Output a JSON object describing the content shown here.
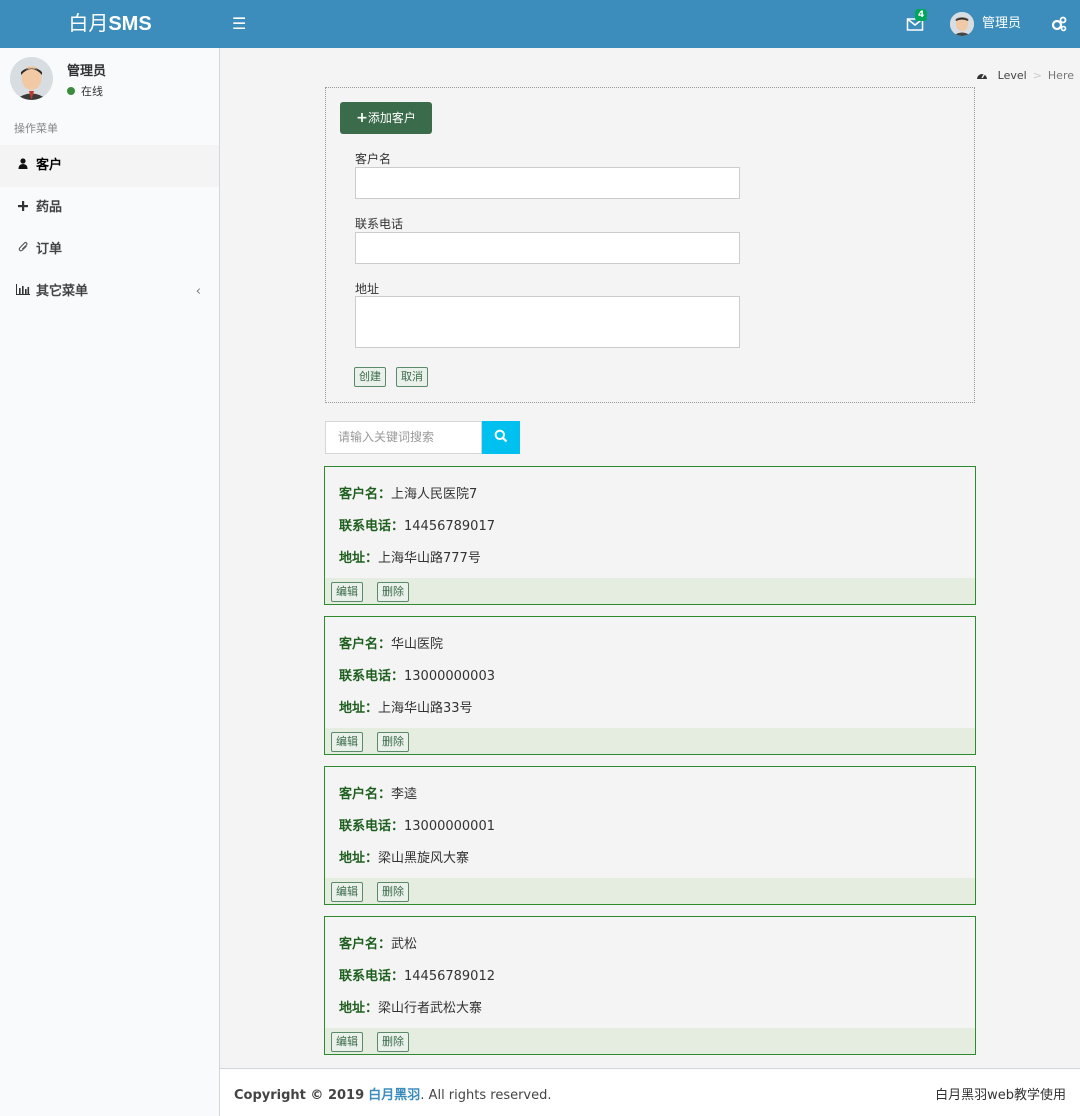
{
  "header": {
    "logo_light": "白月",
    "logo_bold": "SMS",
    "mail_badge": "4",
    "user_name": "管理员"
  },
  "sidebar": {
    "user_name": "管理员",
    "status": "在线",
    "section_header": "操作菜单",
    "items": [
      {
        "label": "客户",
        "icon": "user-icon"
      },
      {
        "label": "药品",
        "icon": "plus-icon"
      },
      {
        "label": "订单",
        "icon": "paperclip-icon"
      },
      {
        "label": "其它菜单",
        "icon": "bar-chart-icon"
      }
    ]
  },
  "breadcrumb": {
    "level": "Level",
    "here": "Here"
  },
  "form": {
    "add_button": "添加客户",
    "name_label": "客户名",
    "name_value": "",
    "phone_label": "联系电话",
    "phone_value": "",
    "address_label": "地址",
    "address_value": "",
    "create_button": "创建",
    "cancel_button": "取消"
  },
  "search": {
    "placeholder": "请输入关键词搜索"
  },
  "customer_labels": {
    "name": "客户名：",
    "phone": "联系电话：",
    "address": "地址：",
    "edit": "编辑",
    "delete": "删除"
  },
  "customers": [
    {
      "name": "上海人民医院7",
      "phone": "14456789017",
      "address": "上海华山路777号"
    },
    {
      "name": "华山医院",
      "phone": "13000000003",
      "address": "上海华山路33号"
    },
    {
      "name": "李逵",
      "phone": "13000000001",
      "address": "梁山黑旋风大寨"
    },
    {
      "name": "武松",
      "phone": "14456789012",
      "address": "梁山行者武松大寨"
    }
  ],
  "footer": {
    "copyright_prefix": "Copyright © 2019",
    "brand": "白月黑羽",
    "copyright_suffix": ". All rights reserved.",
    "right_text": "白月黑羽web教学使用"
  },
  "colors": {
    "header": "#3c8dbc",
    "add_button": "#3a6b4a",
    "search_button": "#00c0ef",
    "card_border": "#2d8a2d",
    "online": "#3d8b3d"
  }
}
